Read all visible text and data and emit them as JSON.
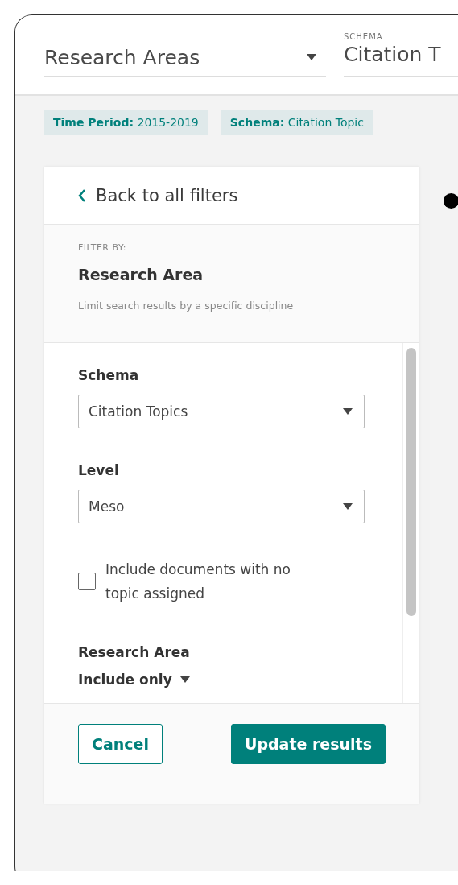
{
  "header": {
    "dropdown": {
      "value": "Research Areas"
    },
    "schema_field": {
      "label": "SCHEMA",
      "value": "Citation T"
    }
  },
  "chips": [
    {
      "key": "Time Period:",
      "value": "2015-2019"
    },
    {
      "key": "Schema:",
      "value": "Citation Topic"
    }
  ],
  "panel": {
    "back_link": "Back to all filters",
    "eyebrow": "FILTER BY:",
    "title": "Research Area",
    "description": "Limit search results by a specific discipline",
    "fields": [
      {
        "kind": "select",
        "label": "Schema",
        "value": "Citation Topics"
      },
      {
        "kind": "select",
        "label": "Level",
        "value": "Meso"
      },
      {
        "kind": "checkbox",
        "label": "Include documents with no topic assigned",
        "checked": false
      },
      {
        "kind": "heading",
        "label": "Research Area"
      },
      {
        "kind": "menu",
        "label": "Include only"
      }
    ],
    "buttons": [
      {
        "kind": "secondary",
        "label": "Cancel"
      },
      {
        "kind": "primary",
        "label": "Update results"
      }
    ]
  }
}
